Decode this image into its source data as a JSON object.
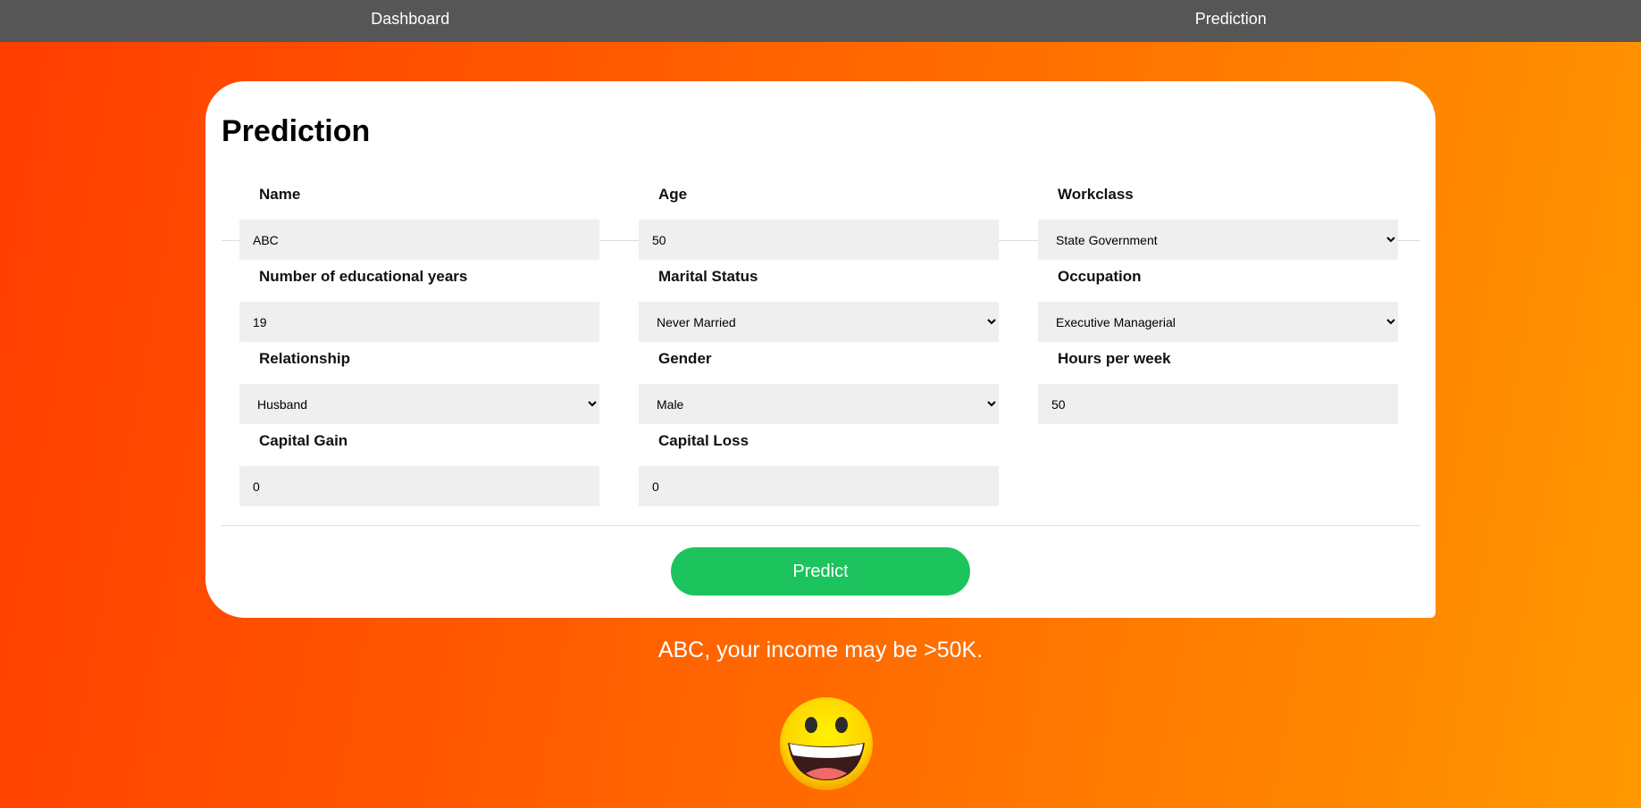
{
  "nav": {
    "items": [
      "Dashboard",
      "Prediction"
    ]
  },
  "card": {
    "title": "Prediction"
  },
  "fields": {
    "name": {
      "label": "Name",
      "value": "ABC"
    },
    "age": {
      "label": "Age",
      "value": "50"
    },
    "workclass": {
      "label": "Workclass",
      "value": "State Government"
    },
    "education": {
      "label": "Number of educational years",
      "value": "19"
    },
    "marital": {
      "label": "Marital Status",
      "value": "Never Married"
    },
    "occupation": {
      "label": "Occupation",
      "value": "Executive Managerial"
    },
    "relationship": {
      "label": "Relationship",
      "value": "Husband"
    },
    "gender": {
      "label": "Gender",
      "value": "Male"
    },
    "hours": {
      "label": "Hours per week",
      "value": "50"
    },
    "gain": {
      "label": "Capital Gain",
      "value": "0"
    },
    "loss": {
      "label": "Capital Loss",
      "value": "0"
    }
  },
  "predict_button": "Predict",
  "result_text": "ABC, your income may be >50K.",
  "result_icon": "grinning-face-icon",
  "colors": {
    "nav": "#565656",
    "button": "#1dc35d",
    "gradient_start": "#ff3d00",
    "gradient_end": "#ff9800"
  }
}
